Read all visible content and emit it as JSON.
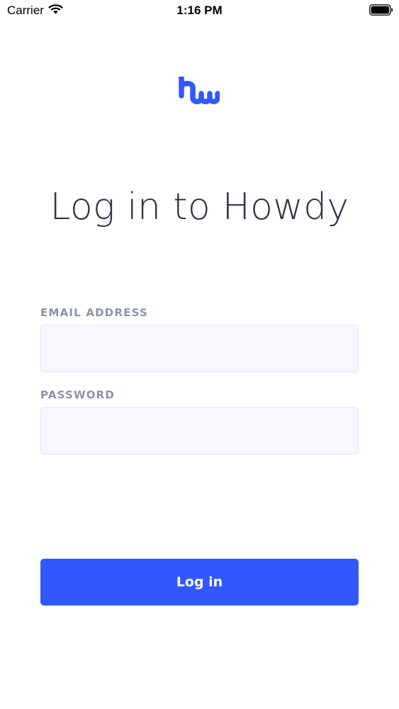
{
  "status_bar": {
    "carrier": "Carrier",
    "time": "1:16 PM",
    "wifi_icon": "wifi-icon",
    "battery_icon": "battery-icon"
  },
  "logo": {
    "icon": "howdy-logo",
    "color": "#3158ff"
  },
  "title": "Log in to Howdy",
  "form": {
    "email": {
      "label": "EMAIL ADDRESS",
      "value": "",
      "placeholder": ""
    },
    "password": {
      "label": "PASSWORD",
      "value": "",
      "placeholder": ""
    },
    "submit_label": "Log in"
  },
  "colors": {
    "accent": "#3158ff",
    "title_text": "#2b3448",
    "label_text": "#8a93a8",
    "input_background": "#f7f8fd"
  }
}
